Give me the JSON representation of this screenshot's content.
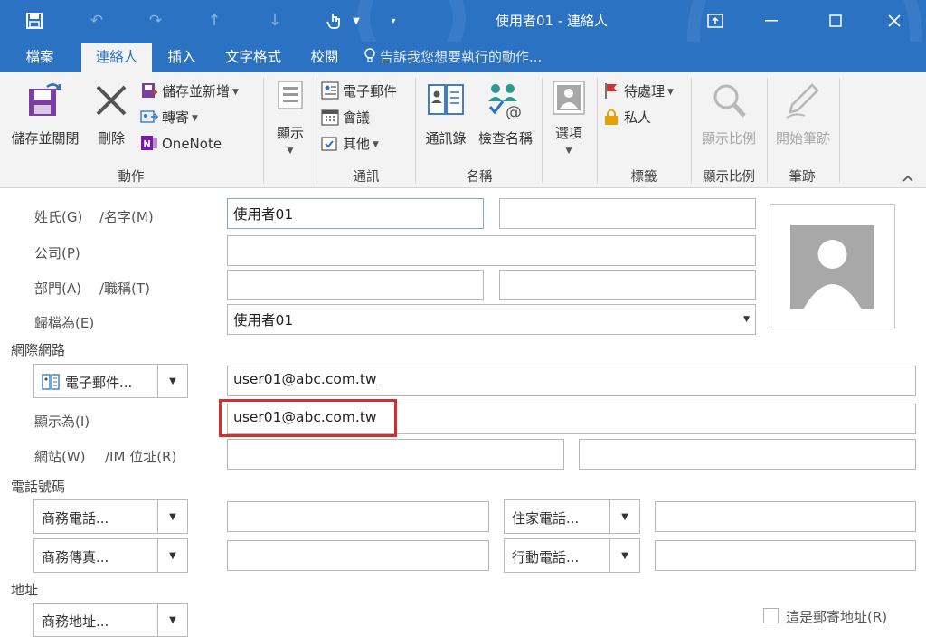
{
  "window": {
    "title": "使用者01 - 連絡人",
    "accent": "#2b72c3",
    "quick_access": [
      "save-icon",
      "undo-icon",
      "redo-icon",
      "up-arrow-icon",
      "down-arrow-icon",
      "touch-mode-icon",
      "customize-icon"
    ],
    "controls": [
      "restore-window-icon",
      "minimize-icon",
      "maximize-icon",
      "close-icon"
    ]
  },
  "tabs": [
    {
      "label": "檔案",
      "active": false
    },
    {
      "label": "連絡人",
      "active": true
    },
    {
      "label": "插入",
      "active": false
    },
    {
      "label": "文字格式",
      "active": false
    },
    {
      "label": "校閱",
      "active": false
    }
  ],
  "tell_me": "告訴我您想要執行的動作...",
  "ribbon": {
    "groups": [
      "動作",
      "通訊",
      "名稱",
      "標籤",
      "顯示比例",
      "筆跡"
    ],
    "save_close": "儲存並關閉",
    "delete": "刪除",
    "save_new": "儲存並新增",
    "forward": "轉寄",
    "onenote": "OneNote",
    "show": "顯示",
    "email": "電子郵件",
    "meeting": "會議",
    "more": "其他",
    "address_book": "通訊錄",
    "check_names": "檢查名稱",
    "options": "選項",
    "follow_up": "待處理",
    "private": "私人",
    "zoom": "顯示比例",
    "start_inking": "開始筆跡"
  },
  "form": {
    "labels": {
      "full_name": "姓氏(G)",
      "given_name": "/名字(M)",
      "company": "公司(P)",
      "department": "部門(A)",
      "job_title": "/職稱(T)",
      "file_as": "歸檔為(E)",
      "display_as": "顯示為(I)",
      "website": "網站(W)",
      "im": "/IM 位址(R)",
      "mailing": "這是郵寄地址(R)"
    },
    "sections": {
      "internet": "網際網路",
      "phone": "電話號碼",
      "address": "地址"
    },
    "values": {
      "last_name": "使用者01",
      "first_name": "",
      "company": "",
      "department": "",
      "job_title": "",
      "file_as": "使用者01",
      "email": "user01@abc.com.tw",
      "display_as": "user01@abc.com.tw",
      "website": "",
      "im": "",
      "business_phone": "",
      "home_phone": "",
      "business_fax": "",
      "mobile_phone": ""
    },
    "buttons": {
      "email": "電子郵件...",
      "business_phone": "商務電話...",
      "home_phone": "住家電話...",
      "business_fax": "商務傳真...",
      "mobile_phone": "行動電話...",
      "business_address": "商務地址..."
    },
    "highlight_color": "#d32f2f",
    "mailing_checked": false
  }
}
